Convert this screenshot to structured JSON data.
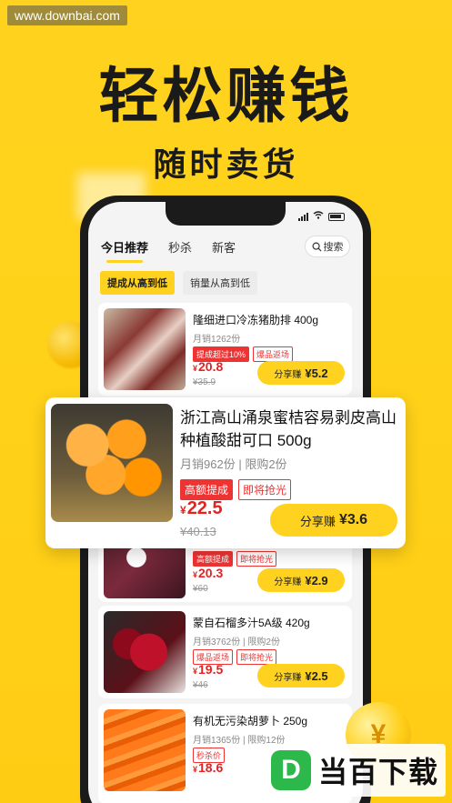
{
  "watermark_top": "www.downbai.com",
  "hero": {
    "title": "轻松赚钱",
    "subtitle": "随时卖货"
  },
  "tabs": [
    {
      "label": "今日推荐"
    },
    {
      "label": "秒杀"
    },
    {
      "label": "新客"
    }
  ],
  "search": {
    "label": "搜索"
  },
  "sort_chips": [
    {
      "label": "提成从高到低"
    },
    {
      "label": "销量从高到低"
    }
  ],
  "products": [
    {
      "title": "隆细进口冷冻猪肋排 400g",
      "sales": "月销1262份",
      "tags": [
        "提成超过10%",
        "爆品返场"
      ],
      "price": "20.8",
      "orig_price": "¥35.9",
      "share_label": "分享赚",
      "share_amount": "¥5.2"
    },
    {
      "title": "",
      "sales": "",
      "tags": [
        "高额提成",
        "即将抢光"
      ],
      "price": "20.3",
      "orig_price": "¥60",
      "share_label": "分享赚",
      "share_amount": "¥2.9"
    },
    {
      "title": "蒙自石榴多汁5A级 420g",
      "sales": "月销3762份",
      "limit": "限购2份",
      "tags": [
        "爆品返场",
        "即将抢光"
      ],
      "price": "19.5",
      "orig_price": "¥46",
      "share_label": "分享赚",
      "share_amount": "¥2.5"
    },
    {
      "title": "有机无污染胡萝卜 250g",
      "sales": "月销1365份",
      "limit": "限购12份",
      "tags": [
        "秒杀价"
      ],
      "price": "18.6",
      "orig_price": "",
      "share_label": "",
      "share_amount": ""
    }
  ],
  "popup": {
    "title": "浙江高山涌泉蜜桔容易剥皮高山种植酸甜可口 500g",
    "sales": "月销962份",
    "limit": "限购2份",
    "tags": [
      "高额提成",
      "即将抢光"
    ],
    "currency": "¥",
    "price": "22.5",
    "orig_price": "¥40.13",
    "share_label": "分享赚",
    "share_amount": "¥3.6"
  },
  "coin_symbol": "¥",
  "watermark_bottom": {
    "logo": "D",
    "text": "当百下载"
  },
  "colors": {
    "brand_yellow": "#ffd21f",
    "price_red": "#e32222"
  }
}
